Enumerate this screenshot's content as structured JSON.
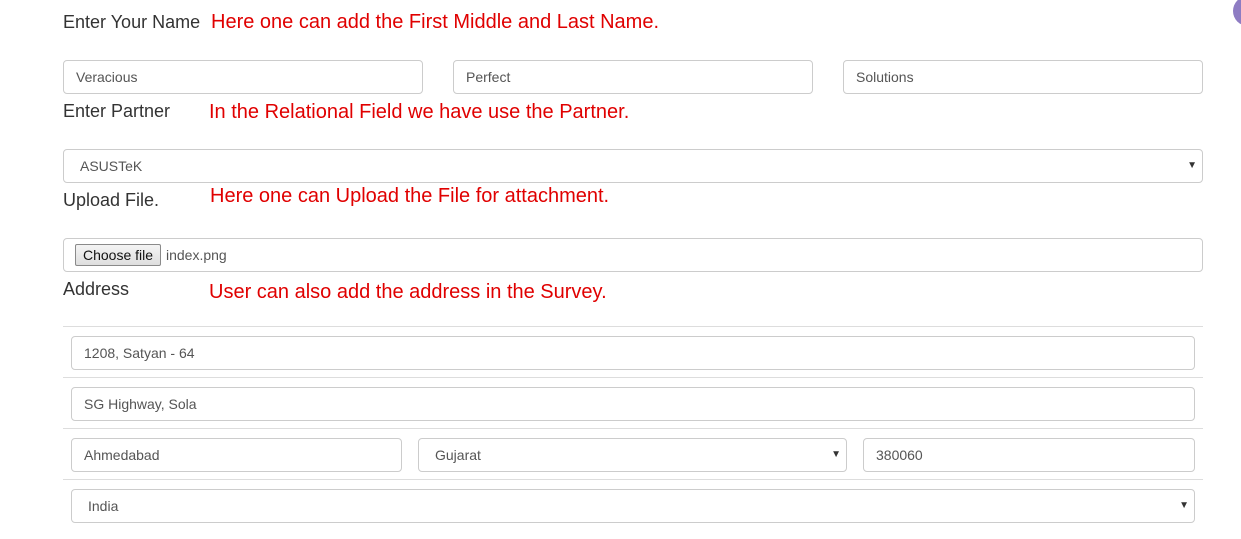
{
  "name_section": {
    "label": "Enter Your Name",
    "note": "Here one can add the First Middle and Last Name.",
    "first": "Veracious",
    "middle": "Perfect",
    "last": "Solutions"
  },
  "partner_section": {
    "label": "Enter Partner",
    "note": "In the Relational Field we have use the Partner.",
    "selected": "ASUSTeK"
  },
  "upload_section": {
    "label": "Upload File.",
    "note": "Here one can Upload the File for attachment.",
    "button_label": "Choose file",
    "file_name": "index.png"
  },
  "address_section": {
    "label": "Address",
    "note": "User can also add the address in the Survey.",
    "street": "1208, Satyan - 64",
    "street2": "SG Highway, Sola",
    "city": "Ahmedabad",
    "state": "Gujarat",
    "zip": "380060",
    "country": "India"
  },
  "icons": {
    "dropdown": "chevron-down-icon",
    "corner": "avatar-dot"
  },
  "colors": {
    "note": "#e00000",
    "corner_dot": "#8e7cc3",
    "border": "#cccccc"
  }
}
